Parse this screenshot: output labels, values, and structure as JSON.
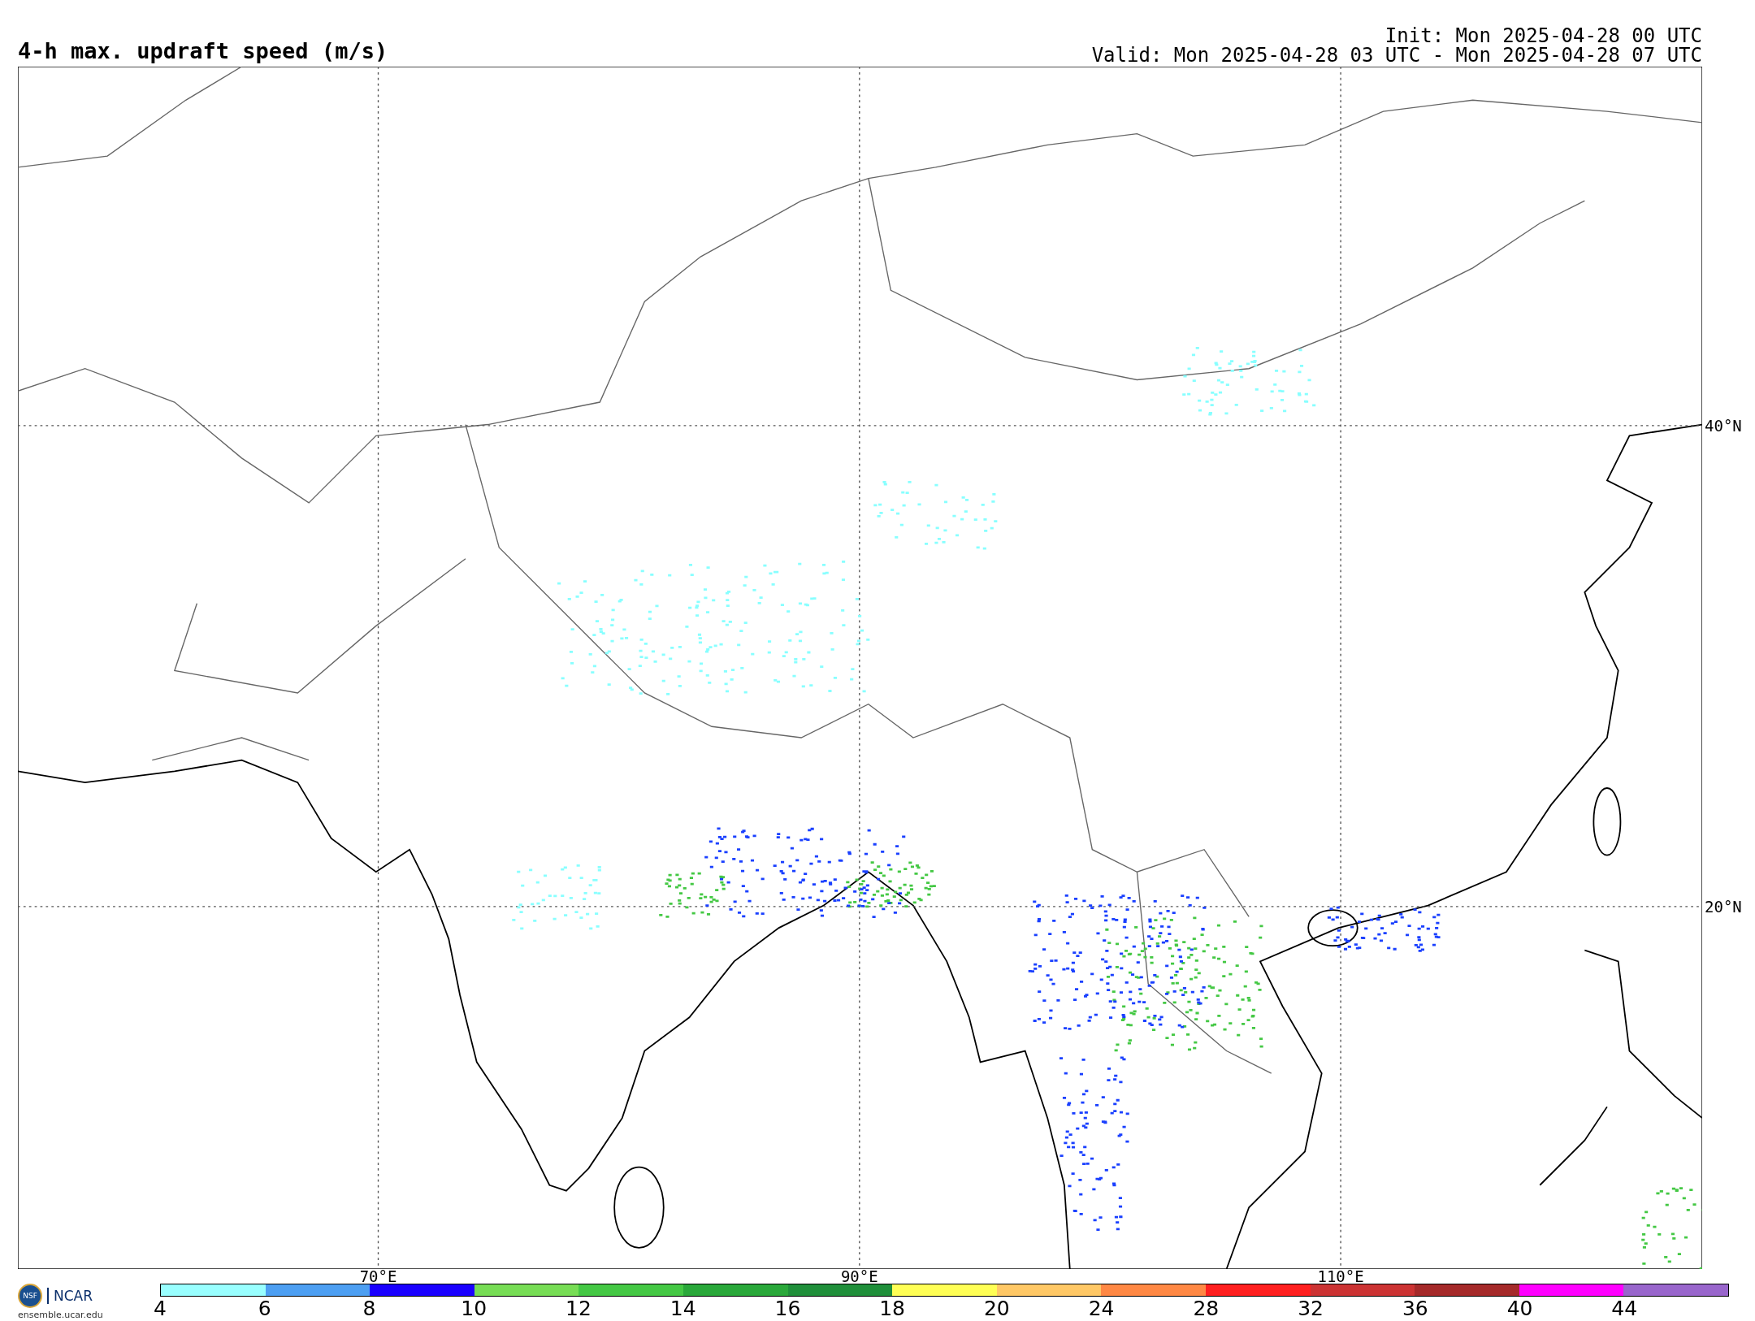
{
  "title": "4-h max. updraft speed (m/s)",
  "init": "Init: Mon 2025-04-28 00 UTC",
  "valid": "Valid: Mon 2025-04-28 03 UTC - Mon 2025-04-28 07 UTC",
  "map": {
    "lon_labels": [
      "70°E",
      "90°E",
      "110°E"
    ],
    "lat_labels": [
      "40°N",
      "20°N"
    ]
  },
  "colorbar": {
    "segments": [
      {
        "color": "#99ffff"
      },
      {
        "color": "#4d9ff2"
      },
      {
        "color": "#1a00ff"
      },
      {
        "color": "#77dd55"
      },
      {
        "color": "#44c844"
      },
      {
        "color": "#2aa83a"
      },
      {
        "color": "#1f8f3a"
      },
      {
        "color": "#ffff55"
      },
      {
        "color": "#ffc866"
      },
      {
        "color": "#ff8844"
      },
      {
        "color": "#ff2020"
      },
      {
        "color": "#cc3333"
      },
      {
        "color": "#a52a2a"
      },
      {
        "color": "#ff00ff"
      },
      {
        "color": "#9966cc"
      }
    ],
    "ticks": [
      "4",
      "6",
      "8",
      "10",
      "12",
      "14",
      "16",
      "18",
      "20",
      "24",
      "28",
      "32",
      "36",
      "40",
      "44"
    ]
  },
  "logo": {
    "badge": "NSF",
    "org": "NCAR",
    "url": "ensemble.ucar.edu"
  }
}
